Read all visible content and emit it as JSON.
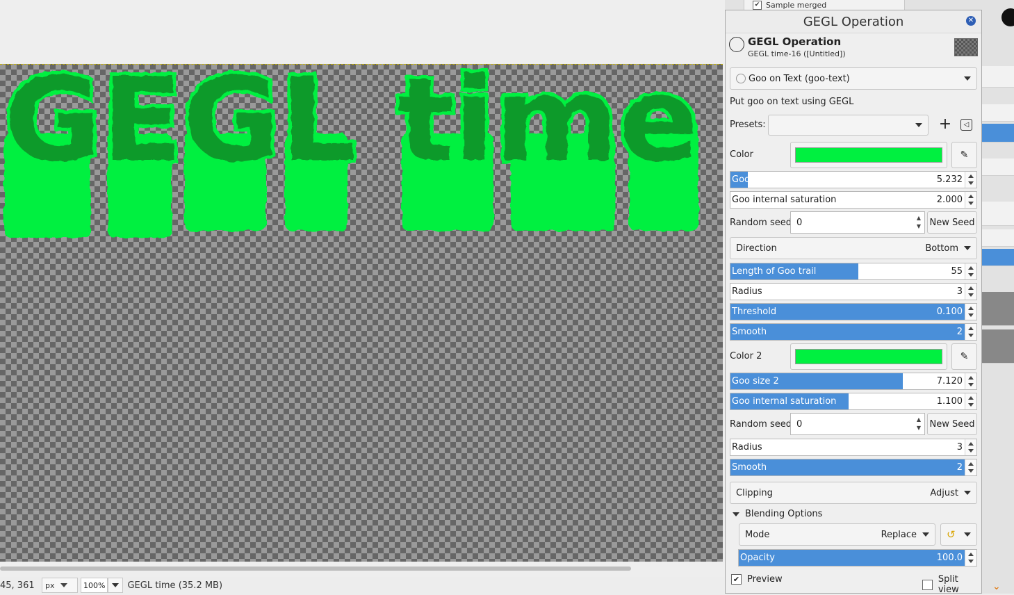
{
  "canvas": {
    "text": "GEGL time",
    "goo_color": "#00f040"
  },
  "statusbar": {
    "coords": "45, 361",
    "unit": "px",
    "zoom": "100%",
    "image_info": "GEGL time (35.2 MB)"
  },
  "dock": {
    "sample_merged_label": "Sample merged",
    "sample_merged_checked": true
  },
  "dialog": {
    "title": "GEGL Operation",
    "op_title": "GEGL Operation",
    "op_subtitle": "GEGL time-16 ([Untitled])",
    "operation": "Goo on Text (goo-text)",
    "description": "Put goo on text using GEGL",
    "presets_label": "Presets:",
    "presets_value": "",
    "add_preset": "+",
    "color_label": "Color",
    "color_value": "#00f040",
    "goo_size_label": "Goo size",
    "goo_size_value": "5.232",
    "goo_size_fraction": 0.07,
    "goo_sat_label": "Goo internal saturation",
    "goo_sat_value": "2.000",
    "goo_sat_fraction": 0.0,
    "seed_label": "Random seed",
    "seed_value": "0",
    "new_seed": "New Seed",
    "direction_label": "Direction",
    "direction_value": "Bottom",
    "trail_label": "Length of Goo trail",
    "trail_value": "55",
    "trail_fraction": 0.52,
    "radius_label": "Radius",
    "radius_value": "3",
    "radius_fraction": 0.0,
    "threshold_label": "Threshold",
    "threshold_value": "0.100",
    "threshold_fraction": 1.0,
    "smooth_label": "Smooth",
    "smooth_value": "2",
    "smooth_fraction": 1.0,
    "color2_label": "Color 2",
    "color2_value": "#00f040",
    "goo_size2_label": "Goo size 2",
    "goo_size2_value": "7.120",
    "goo_size2_fraction": 0.7,
    "goo_sat2_label": "Goo internal saturation",
    "goo_sat2_value": "1.100",
    "goo_sat2_fraction": 0.48,
    "seed2_label": "Random seed",
    "seed2_value": "0",
    "new_seed2": "New Seed",
    "radius2_label": "Radius",
    "radius2_value": "3",
    "radius2_fraction": 0.0,
    "smooth2_label": "Smooth",
    "smooth2_value": "2",
    "smooth2_fraction": 1.0,
    "clipping_label": "Clipping",
    "clipping_value": "Adjust",
    "blending_label": "Blending Options",
    "mode_label": "Mode",
    "mode_value": "Replace",
    "opacity_label": "Opacity",
    "opacity_value": "100.0",
    "opacity_fraction": 1.0,
    "preview_label": "Preview",
    "preview_checked": true,
    "split_label": "Split view",
    "split_checked": false
  }
}
